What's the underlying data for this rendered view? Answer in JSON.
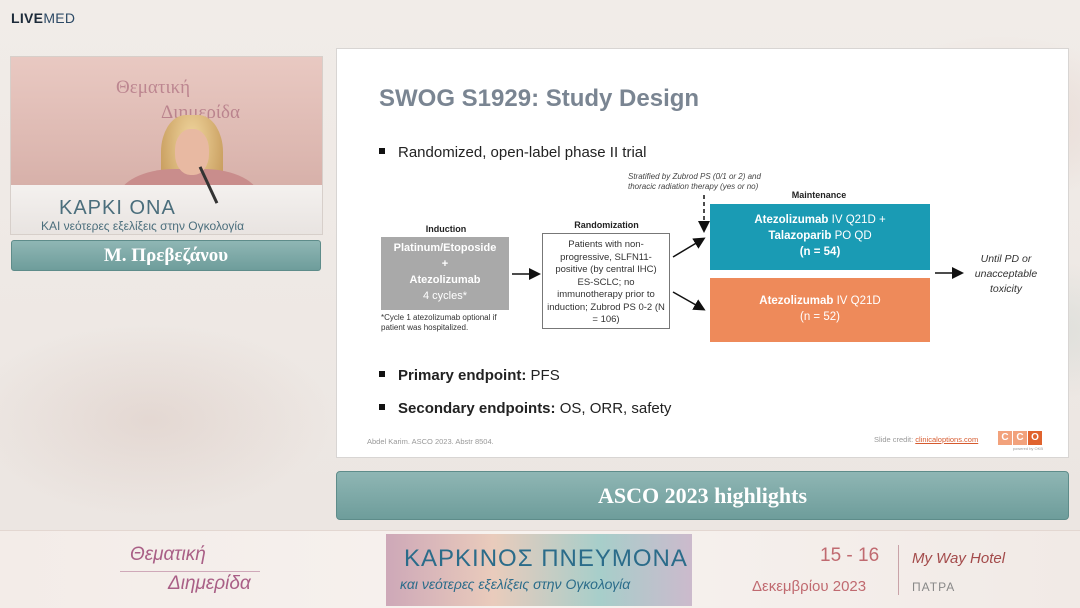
{
  "brand": {
    "live": "LIVE",
    "med": "MED"
  },
  "video": {
    "backdrop_line1": "Θεματική",
    "backdrop_line2": "Διημερίδα",
    "desk_line1": "ΚΑΡΚΙ  ΟΝΑ",
    "desk_line2": "ΚΑΙ νεότερες εξελίξεις στην Ογκολογία"
  },
  "speaker": {
    "name": "Μ. Πρεβεζάνου"
  },
  "slide": {
    "title": "SWOG S1929: Study Design",
    "bullet1": "Randomized, open-label phase II trial",
    "stratified_line1": "Stratified by Zubrod PS (0/1 or 2) and",
    "stratified_line2": "thoracic radiation therapy (yes or no)",
    "maintenance_label": "Maintenance",
    "induction_label": "Induction",
    "randomization_label": "Randomization",
    "induction_box": {
      "line1": "Platinum/Etoposide",
      "line2": "+",
      "line3": "Atezolizumab",
      "line4": "4 cycles*"
    },
    "induction_note_line1": "*Cycle 1 atezolizumab optional if",
    "induction_note_line2": "patient was hospitalized.",
    "randomization_box": "Patients with non-progressive, SLFN11-positive (by central IHC) ES-SCLC; no immunotherapy prior to induction; Zubrod PS 0-2 (N = 106)",
    "arm1": {
      "drug1": "Atezolizumab",
      "drug1_rest": " IV Q21D +",
      "drug2": "Talazoparib",
      "drug2_rest": " PO QD",
      "n": "(n = 54)"
    },
    "arm2": {
      "drug1": "Atezolizumab",
      "drug1_rest": " IV Q21D",
      "n": "(n = 52)"
    },
    "outcome_line1": "Until PD or",
    "outcome_line2": "unacceptable",
    "outcome_line3": "toxicity",
    "primary_label": "Primary endpoint:",
    "primary_value": " PFS",
    "secondary_label": "Secondary endpoints:",
    "secondary_value": " OS, ORR, safety",
    "footer_citation": "Abdel Karim. ASCO 2023. Abstr 8504.",
    "footer_credit": "Slide credit: ",
    "footer_link": "clinicaloptions.com",
    "cco_letters": [
      "C",
      "C",
      "O"
    ],
    "cco_tagline": "powered by OKB"
  },
  "highlight": "ASCO 2023 highlights",
  "banner": {
    "left1": "Θεματική",
    "left2": "Διημερίδα",
    "center1": "ΚΑΡΚΙΝΟΣ ΠΝΕΥΜΟΝΑ",
    "center2": "και νεότερες εξελίξεις στην Ογκολογία",
    "date1": "15 - 16",
    "date2": "Δεκεμβρίου 2023",
    "hotel": "My Way Hotel",
    "city": "ΠΑΤΡΑ"
  },
  "colors": {
    "teal_arm": "#1a9bb4",
    "orange_arm": "#ee8a5a",
    "induction_gray": "#a9a9a9",
    "plate_teal": "#7aa7a5"
  }
}
